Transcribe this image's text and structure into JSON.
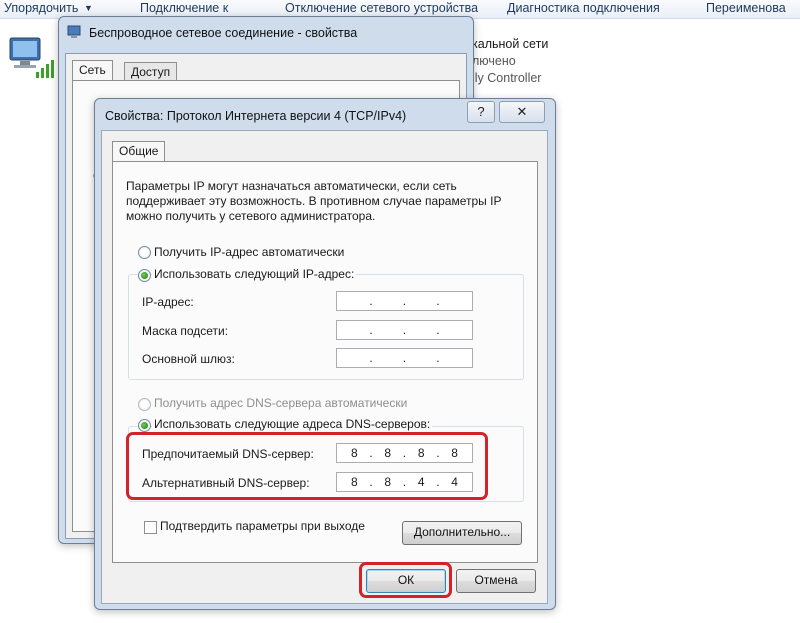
{
  "toolbar": {
    "organize": "Упорядочить",
    "connect": "Подключение к",
    "disconnect": "Отключение сетевого устройства",
    "diagnose": "Диагностика подключения",
    "rename": "Переименова"
  },
  "background_item": {
    "line1": "кальной сети",
    "line2": "лючено",
    "line3": "ily Controller"
  },
  "outer_window": {
    "title": "Беспроводное сетевое соединение - свойства",
    "tabs": [
      "Сеть",
      "Доступ"
    ],
    "frag_p": "П",
    "frag_c": "С"
  },
  "dialog": {
    "title": "Свойства: Протокол Интернета версии 4 (TCP/IPv4)",
    "help": "?",
    "close": "✕",
    "tab": "Общие",
    "description": "Параметры IP могут назначаться автоматически, если сеть поддерживает эту возможность. В противном случае параметры IP можно получить у сетевого администратора.",
    "ip_auto": "Получить IP-адрес автоматически",
    "ip_manual": "Использовать следующий IP-адрес:",
    "ip_address_label": "IP-адрес:",
    "subnet_label": "Маска подсети:",
    "gateway_label": "Основной шлюз:",
    "dns_auto": "Получить адрес DNS-сервера автоматически",
    "dns_manual": "Использовать следующие адреса DNS-серверов:",
    "preferred_dns_label": "Предпочитаемый DNS-сервер:",
    "preferred_dns": [
      "8",
      "8",
      "8",
      "8"
    ],
    "alternate_dns_label": "Альтернативный DNS-сервер:",
    "alternate_dns": [
      "8",
      "8",
      "4",
      "4"
    ],
    "validate_label": "Подтвердить параметры при выходе",
    "advanced_button": "Дополнительно...",
    "ok_button": "ОК",
    "cancel_button": "Отмена"
  }
}
